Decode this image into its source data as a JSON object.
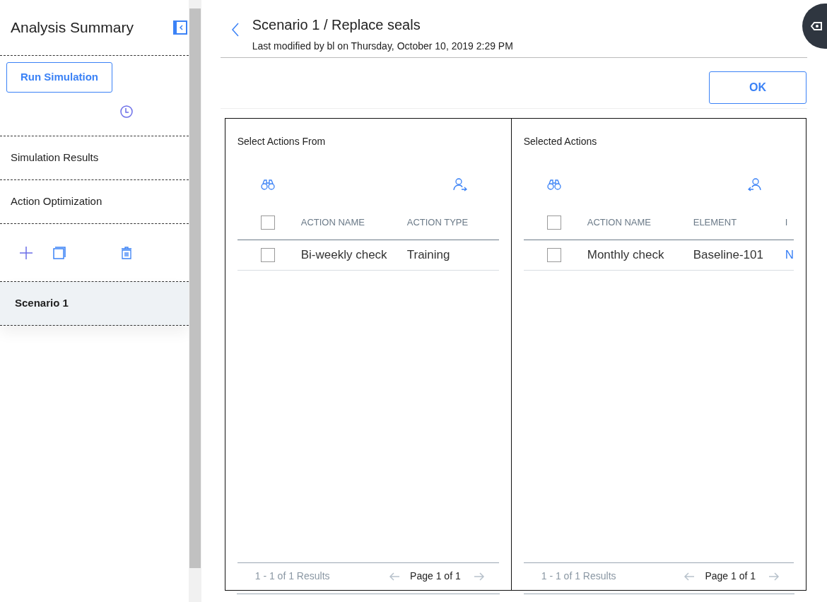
{
  "sidebar": {
    "title": "Analysis Summary",
    "run_button": "Run Simulation",
    "items": [
      {
        "label": "Simulation Results",
        "selected": false
      },
      {
        "label": "Action Optimization",
        "selected": false
      }
    ],
    "scenarios": [
      {
        "label": "Scenario 1",
        "selected": true
      }
    ]
  },
  "header": {
    "title": "Scenario 1 / Replace seals",
    "subtitle": "Last modified by bl on Thursday, October 10, 2019 2:29 PM",
    "ok_button": "OK"
  },
  "panels": [
    {
      "title": "Select Actions From",
      "kind": "source",
      "all_checked": false,
      "columns": [
        "ACTION NAME",
        "ACTION TYPE"
      ],
      "rows": [
        {
          "checked": false,
          "cells": [
            "Bi-weekly check",
            "Training"
          ]
        }
      ],
      "results": "1 - 1 of 1 Results",
      "page": "Page 1 of 1"
    },
    {
      "title": "Selected Actions",
      "kind": "target",
      "all_checked": false,
      "columns": [
        "ACTION NAME",
        "ELEMENT",
        "I"
      ],
      "rows": [
        {
          "checked": false,
          "cells": [
            "Monthly check",
            "Baseline-101",
            "N"
          ]
        }
      ],
      "results": "1 - 1 of 1 Results",
      "page": "Page 1 of 1"
    }
  ]
}
